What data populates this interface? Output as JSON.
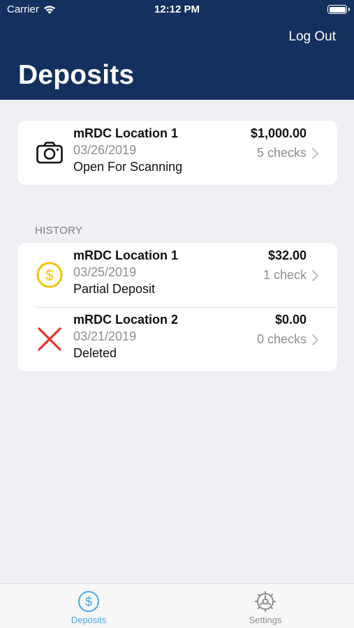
{
  "status_bar": {
    "carrier": "Carrier",
    "time": "12:12 PM"
  },
  "header": {
    "logout_label": "Log Out",
    "title": "Deposits"
  },
  "current": {
    "location": "mRDC Location 1",
    "date": "03/26/2019",
    "status": "Open For Scanning",
    "amount": "$1,000.00",
    "count": "5 checks",
    "icon": "camera-icon"
  },
  "history": {
    "header": "HISTORY",
    "items": [
      {
        "location": "mRDC Location 1",
        "date": "03/25/2019",
        "status": "Partial Deposit",
        "amount": "$32.00",
        "count": "1 check",
        "icon": "dollar-coin-icon"
      },
      {
        "location": "mRDC Location 2",
        "date": "03/21/2019",
        "status": "Deleted",
        "amount": "$0.00",
        "count": "0 checks",
        "icon": "x-icon"
      }
    ]
  },
  "tabs": [
    {
      "label": "Deposits",
      "icon": "dollar-circle-icon",
      "active": true
    },
    {
      "label": "Settings",
      "icon": "gear-icon",
      "active": false
    }
  ],
  "colors": {
    "header_bg": "#13305e",
    "page_bg": "#efeff4",
    "active_tab": "#4aa7e6",
    "coin_yellow": "#f5c400",
    "delete_red": "#e8322c"
  }
}
